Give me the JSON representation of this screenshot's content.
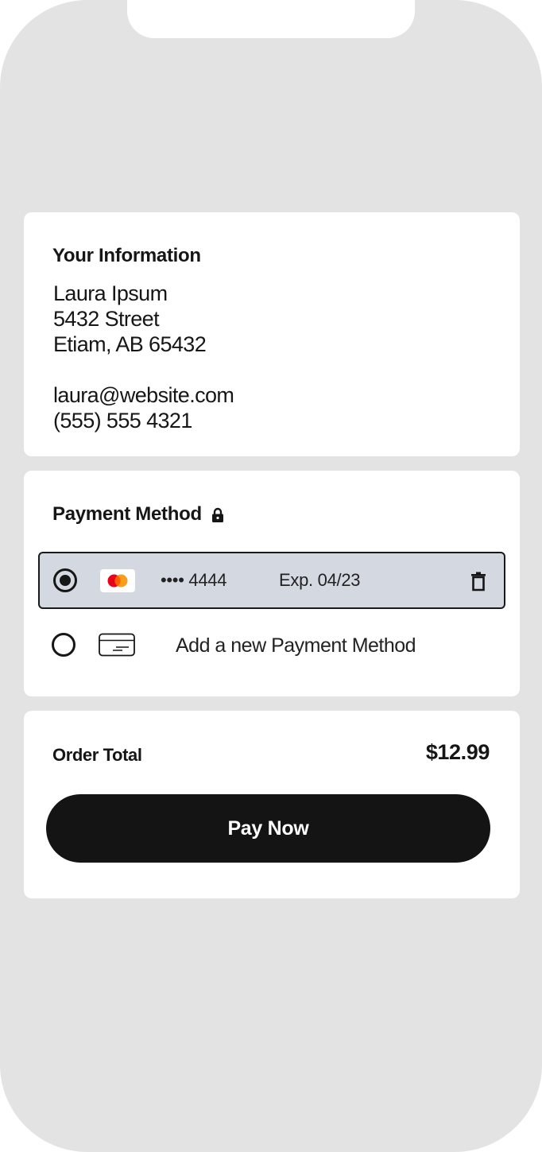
{
  "info": {
    "title": "Your Information",
    "name": "Laura Ipsum",
    "street": "5432 Street",
    "city_line": "Etiam, AB 65432",
    "email": "laura@website.com",
    "phone": "(555) 555 4321"
  },
  "payment": {
    "title": "Payment Method",
    "title_icon": "lock-icon",
    "saved_card": {
      "brand": "mastercard",
      "number": "•••• 4444",
      "expiry": "Exp. 04/23",
      "selected": true
    },
    "add_new_label": "Add a new Payment Method"
  },
  "order": {
    "total_label": "Order Total",
    "total_value": "$12.99",
    "pay_label": "Pay Now"
  },
  "colors": {
    "background": "#e3e3e3",
    "card": "#ffffff",
    "selected_row": "#d4d8e1",
    "button": "#141414",
    "mastercard_red": "#eb001b",
    "mastercard_orange": "#f79e1b"
  }
}
